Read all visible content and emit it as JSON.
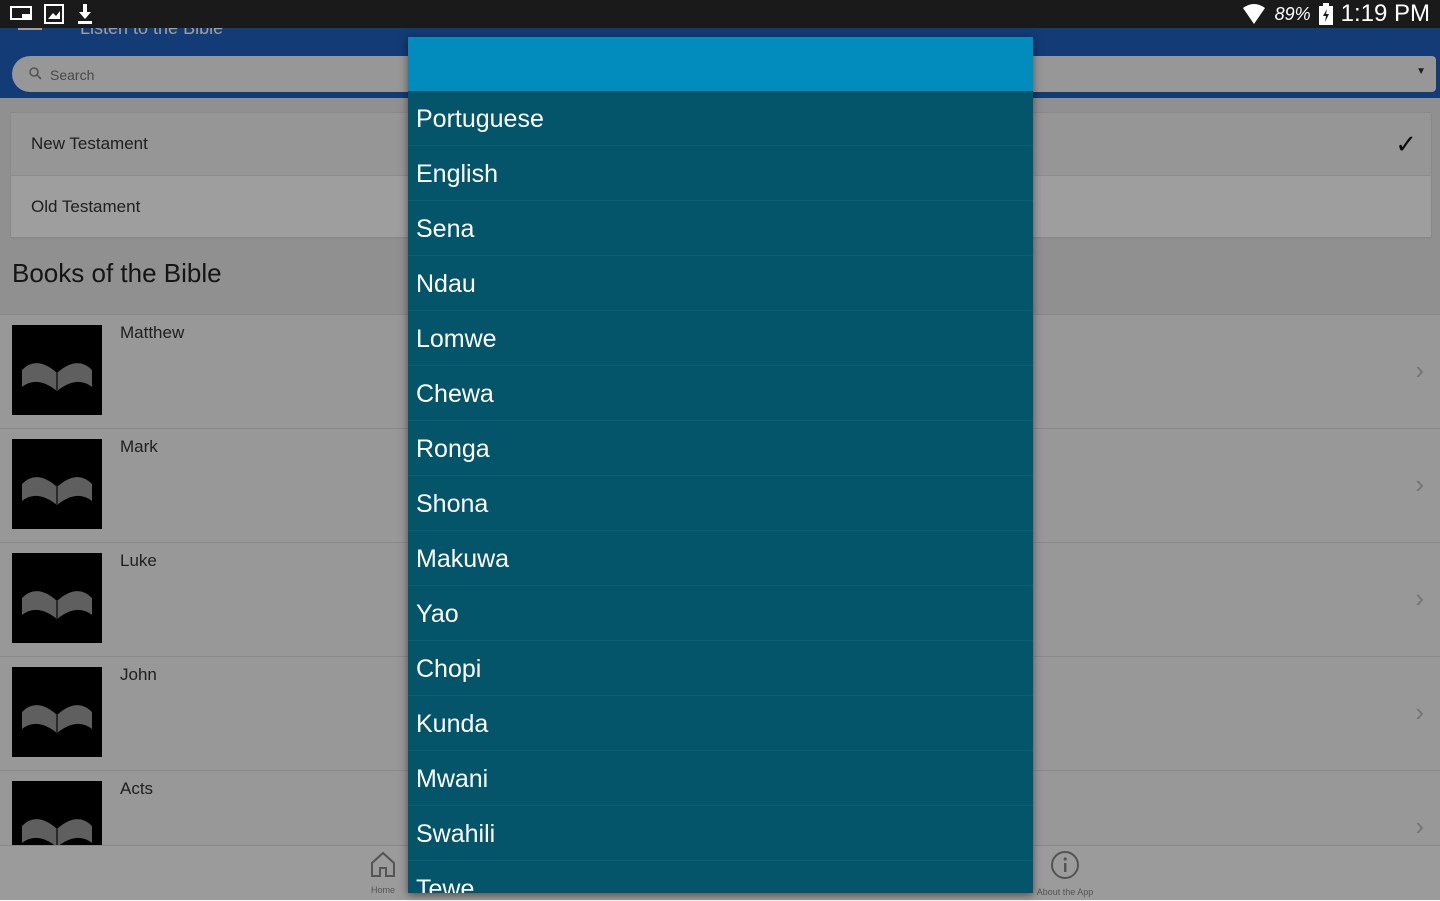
{
  "status_bar": {
    "battery_pct": "89%",
    "time": "1:19 PM",
    "icons": [
      "cast-icon",
      "image-icon",
      "download-icon",
      "wifi-icon",
      "battery-charging-icon"
    ]
  },
  "header": {
    "title": "Listen to the Bible",
    "search_placeholder": "Search"
  },
  "testaments": [
    {
      "label": "New Testament",
      "selected": true
    },
    {
      "label": "Old Testament",
      "selected": false
    }
  ],
  "books_title": "Books of the Bible",
  "books": [
    {
      "name": "Matthew"
    },
    {
      "name": "Mark"
    },
    {
      "name": "Luke"
    },
    {
      "name": "John"
    },
    {
      "name": "Acts"
    }
  ],
  "bottom_nav": {
    "home_label": "Home",
    "about_label": "About the App"
  },
  "dropdown": {
    "options": [
      "Portuguese",
      "English",
      "Sena",
      "Ndau",
      "Lomwe",
      "Chewa",
      "Ronga",
      "Shona",
      "Makuwa",
      "Yao",
      "Chopi",
      "Kunda",
      "Mwani",
      "Swahili",
      "Tewe"
    ]
  },
  "colors": {
    "header_blue": "#1f5fbf",
    "dropdown_bg": "#04546a",
    "dropdown_header": "#028bbd"
  }
}
